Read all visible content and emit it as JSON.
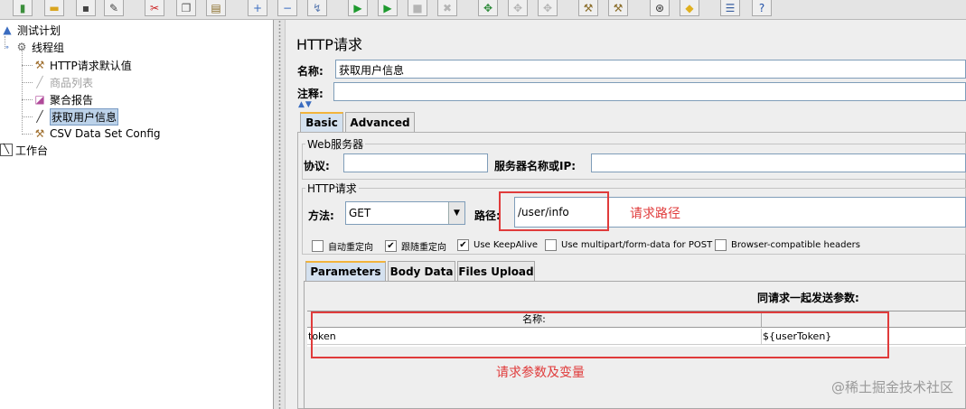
{
  "toolbar": {
    "buttons": [
      {
        "icon": "green-book-icon",
        "glyph": "▮",
        "color": "#3c8f3c"
      },
      {
        "icon": "open-folder-icon",
        "glyph": "▬",
        "color": "#d9a520"
      },
      {
        "icon": "save-icon",
        "glyph": "▪",
        "color": "#444444"
      },
      {
        "icon": "save-as-icon",
        "glyph": "✎",
        "color": "#444444"
      },
      {
        "icon": "cut-icon",
        "glyph": "✂",
        "color": "#cc2222"
      },
      {
        "icon": "copy-icon",
        "glyph": "❐",
        "color": "#555555"
      },
      {
        "icon": "paste-icon",
        "glyph": "▤",
        "color": "#8a6d2a"
      },
      {
        "icon": "expand-icon",
        "glyph": "+",
        "color": "#3a6cc0"
      },
      {
        "icon": "collapse-icon",
        "glyph": "−",
        "color": "#3a6cc0"
      },
      {
        "icon": "toggle-icon",
        "glyph": "↯",
        "color": "#5a7ab0"
      },
      {
        "icon": "start-icon",
        "glyph": "▶",
        "color": "#1e9a2e"
      },
      {
        "icon": "start-no-pause-icon",
        "glyph": "▶",
        "color": "#1e9a2e"
      },
      {
        "icon": "stop-icon",
        "glyph": "■",
        "color": "#b5b5b5"
      },
      {
        "icon": "shutdown-icon",
        "glyph": "✖",
        "color": "#b5b5b5"
      },
      {
        "icon": "remote-start-icon",
        "glyph": "✥",
        "color": "#2e8a3a"
      },
      {
        "icon": "remote-stop-icon",
        "glyph": "✥",
        "color": "#b5b5b5"
      },
      {
        "icon": "remote-shutdown-icon",
        "glyph": "✥",
        "color": "#b5b5b5"
      },
      {
        "icon": "clear-icon",
        "glyph": "⚒",
        "color": "#8a6d2a"
      },
      {
        "icon": "clear-all-icon",
        "glyph": "⚒",
        "color": "#8a6d2a"
      },
      {
        "icon": "search-icon",
        "glyph": "⊛",
        "color": "#333333"
      },
      {
        "icon": "reset-search-icon",
        "glyph": "◆",
        "color": "#e0b020"
      },
      {
        "icon": "function-helper-icon",
        "glyph": "☰",
        "color": "#3a5fa0"
      },
      {
        "icon": "help-icon",
        "glyph": "?",
        "color": "#1f4fa8"
      }
    ]
  },
  "tree": {
    "test_plan": "测试计划",
    "thread_group": "线程组",
    "items": [
      {
        "label": "HTTP请求默认值",
        "icon": "wrench-icon",
        "glyph": "⚒",
        "color": "#a07030",
        "disabled": false
      },
      {
        "label": "商品列表",
        "icon": "dropper-icon",
        "glyph": "╱",
        "color": "#b0b0b0",
        "disabled": true
      },
      {
        "label": "聚合报告",
        "icon": "chart-icon",
        "glyph": "◪",
        "color": "#b04a9a",
        "disabled": false
      },
      {
        "label": "获取用户信息",
        "icon": "dropper-icon",
        "glyph": "╱",
        "color": "#333333",
        "disabled": false,
        "selected": true
      },
      {
        "label": "CSV Data Set Config",
        "icon": "wrench-icon",
        "glyph": "⚒",
        "color": "#a07030",
        "disabled": false
      }
    ],
    "workbench": "工作台"
  },
  "panel": {
    "title": "HTTP请求",
    "name_label": "名称:",
    "name_value": "获取用户信息",
    "comment_label": "注释:",
    "comment_value": "",
    "tabs": [
      "Basic",
      "Advanced"
    ],
    "web_server": {
      "title": "Web服务器",
      "protocol_label": "协议:",
      "protocol_value": "",
      "server_label": "服务器名称或IP:",
      "server_value": ""
    },
    "http_request": {
      "title": "HTTP请求",
      "method_label": "方法:",
      "method_value": "GET",
      "path_label": "路径:",
      "path_value": "/user/info"
    },
    "checkboxes": [
      {
        "label": "自动重定向",
        "checked": false
      },
      {
        "label": "跟随重定向",
        "checked": true
      },
      {
        "label": "Use KeepAlive",
        "checked": true
      },
      {
        "label": "Use multipart/form-data for POST",
        "checked": false
      },
      {
        "label": "Browser-compatible headers",
        "checked": false
      }
    ],
    "sub_tabs": [
      "Parameters",
      "Body Data",
      "Files Upload"
    ],
    "params_heading": "同请求一起发送参数:",
    "table": {
      "headers": [
        "名称:",
        ""
      ],
      "rows": [
        [
          "token",
          "${userToken}"
        ]
      ]
    }
  },
  "annotations": {
    "path_note": "请求路径",
    "params_note": "请求参数及变量"
  },
  "watermark": "@稀土掘金技术社区",
  "colors": {
    "annotation_red": "#e03b3b",
    "selection_blue": "#bcd2e9",
    "active_tab_orange": "#f2b43c"
  }
}
